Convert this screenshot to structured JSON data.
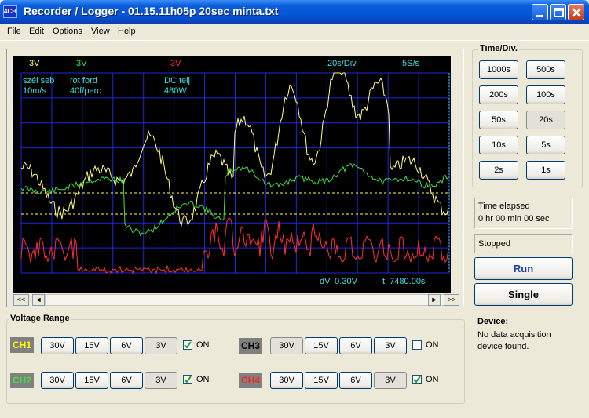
{
  "window": {
    "icon_text": "4CH",
    "title": "Recorder / Logger - 01.15.11h05p 20sec minta.txt"
  },
  "menu": [
    "File",
    "Edit",
    "Options",
    "View",
    "Help"
  ],
  "scope": {
    "top_labels": [
      {
        "text": "3V",
        "color": "#FFFF80"
      },
      {
        "text": "3V",
        "color": "#40E040"
      },
      {
        "text": "3V",
        "color": "#FF3030"
      },
      {
        "text": "20s/Div.",
        "color": "#40E0E0"
      },
      {
        "text": "5S/s",
        "color": "#40E0E0"
      }
    ],
    "channel_info": [
      {
        "line1": "szél seb",
        "line2": "10m/s"
      },
      {
        "line1": "rot ford",
        "line2": "40f/perc"
      },
      {
        "line1": "DC telj",
        "line2": "480W"
      }
    ],
    "dv": "dV: 0.30V",
    "t": "t: 7480.00s",
    "colors": {
      "grid": "#1E28D8",
      "ch1": "#FFFF80",
      "ch2": "#40E040",
      "ch4": "#FF3030",
      "text": "#40E0E0"
    }
  },
  "scroll": {
    "first": "<<",
    "prev": "◄",
    "next": "►",
    "last": ">>"
  },
  "time_div": {
    "title": "Time/Div.",
    "buttons": [
      "1000s",
      "500s",
      "200s",
      "100s",
      "50s",
      "20s",
      "10s",
      "5s",
      "2s",
      "1s"
    ],
    "selected": "20s"
  },
  "status": {
    "time_elapsed_label": "Time elapsed",
    "time_elapsed_value": "0 hr  00 min  00 sec",
    "state": "Stopped"
  },
  "controls": {
    "run": "Run",
    "single": "Single"
  },
  "device": {
    "label": "Device:",
    "line1": "No data acquisition",
    "line2": "device found."
  },
  "voltage_range": {
    "title": "Voltage Range",
    "ranges": [
      "30V",
      "15V",
      "6V",
      "3V"
    ],
    "on_label": "ON",
    "channels": [
      {
        "name": "CH1",
        "color": "#FFFF00",
        "selected": "3V",
        "on": true
      },
      {
        "name": "CH2",
        "color": "#40E040",
        "selected": "3V",
        "on": true
      },
      {
        "name": "CH3",
        "color": "#000000",
        "selected": "30V",
        "on": false
      },
      {
        "name": "CH4",
        "color": "#FF2020",
        "selected": "3V",
        "on": true
      }
    ]
  }
}
